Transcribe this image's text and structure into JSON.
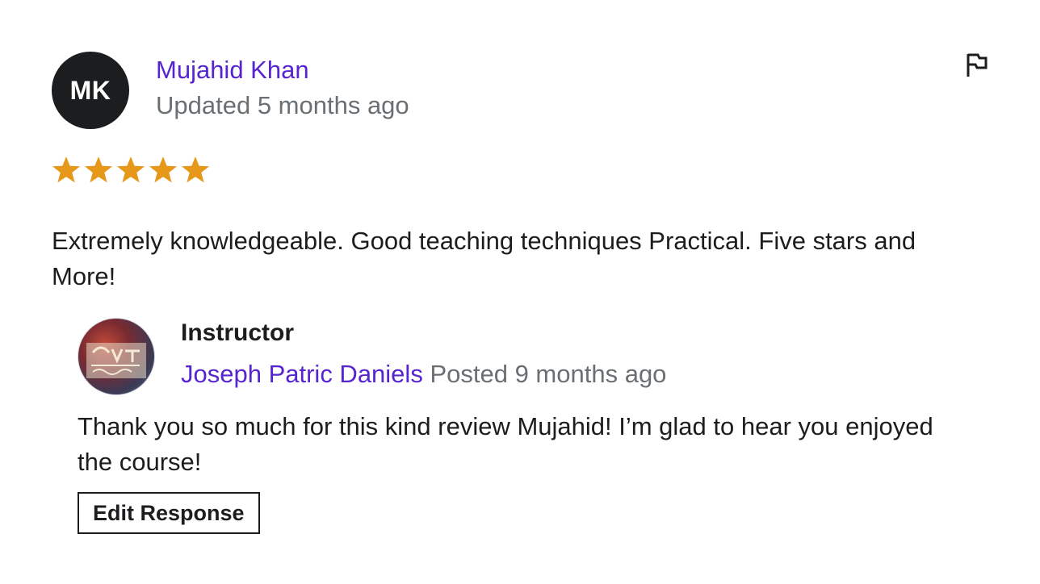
{
  "review": {
    "avatar_initials": "MK",
    "reviewer_name": "Mujahid Khan",
    "meta": "Updated 5 months ago",
    "rating": 5,
    "rating_max": 5,
    "star_color": "#e59819",
    "text": "Extremely knowledgeable. Good teaching techniques Practical. Five stars and More!",
    "flag_icon": "flag-icon"
  },
  "response": {
    "role": "Instructor",
    "instructor_name": "Joseph Patric Daniels",
    "posted": "Posted 9 months ago",
    "text": "Thank you so much for this kind review Mujahid! I’m glad to hear you enjoyed the course!",
    "edit_label": "Edit Response",
    "avatar_icon": "paint-beginner-master-logo"
  },
  "colors": {
    "link": "#5624d0",
    "muted": "#6a6f73",
    "text": "#1c1d1f"
  }
}
